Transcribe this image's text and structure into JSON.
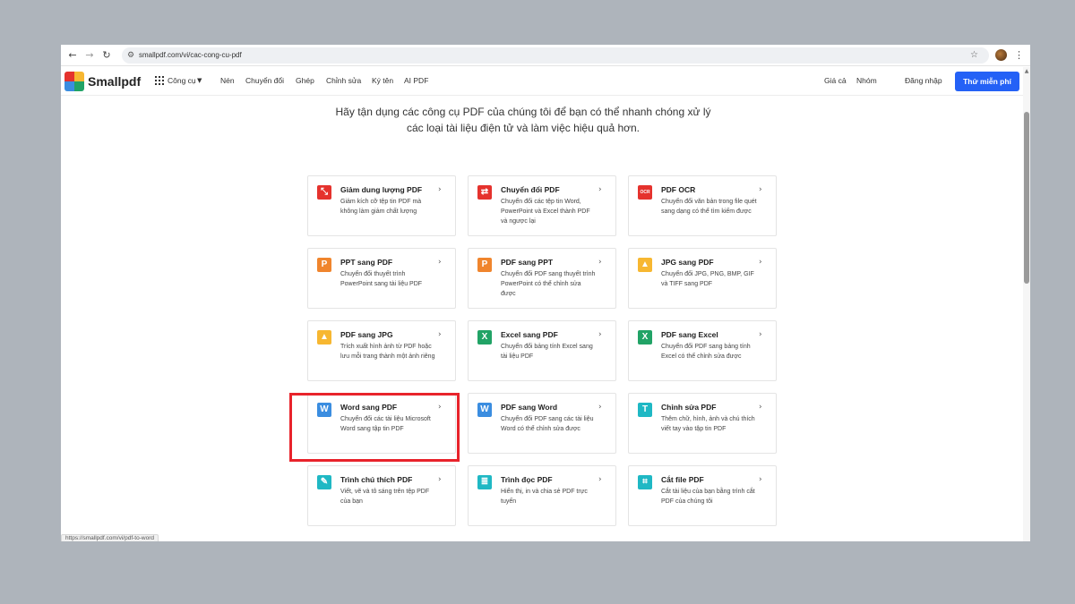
{
  "browser": {
    "back_icon": "arrow-left-icon",
    "forward_icon": "arrow-right-icon",
    "reload_icon": "reload-icon",
    "url": "smallpdf.com/vi/cac-cong-cu-pdf",
    "status_url": "https://smallpdf.com/vi/pdf-to-word"
  },
  "header": {
    "brand": "Smallpdf",
    "tools_label": "Công cụ",
    "nav": [
      "Nén",
      "Chuyển đổi",
      "Ghép",
      "Chỉnh sửa",
      "Ký tên",
      "AI PDF"
    ],
    "right_links": [
      "Giá cả",
      "Nhóm",
      "Đăng nhập"
    ],
    "cta": "Thử miễn phí",
    "cta_color": "#2461f6"
  },
  "intro": {
    "line1": "Hãy tận dụng các công cụ PDF của chúng tôi để bạn có thể nhanh chóng xử lý",
    "line2": "các loại tài liệu điện tử và làm việc hiệu quả hơn."
  },
  "cards": [
    {
      "title": "Giảm dung lượng PDF",
      "desc": "Giảm kích cỡ tệp tin PDF mà không làm giảm chất lượng",
      "icon": "compress-icon",
      "color": "#e5322d",
      "glyph": "⤡"
    },
    {
      "title": "Chuyển đổi PDF",
      "desc": "Chuyển đổi các tệp tin Word, PowerPoint và Excel thành PDF và ngược lại",
      "icon": "convert-icon",
      "color": "#e5322d",
      "glyph": "⇄"
    },
    {
      "title": "PDF OCR",
      "desc": "Chuyển đổi văn bản trong file quét sang dạng có thể tìm kiếm được",
      "icon": "ocr-icon",
      "color": "#e5322d",
      "glyph": "OCR"
    },
    {
      "title": "PPT sang PDF",
      "desc": "Chuyển đổi thuyết trình PowerPoint sang tài liệu PDF",
      "icon": "powerpoint-icon",
      "color": "#f0852d",
      "glyph": "P"
    },
    {
      "title": "PDF sang PPT",
      "desc": "Chuyển đổi PDF sang thuyết trình PowerPoint có thể chỉnh sửa được",
      "icon": "powerpoint-icon",
      "color": "#f0852d",
      "glyph": "P"
    },
    {
      "title": "JPG sang PDF",
      "desc": "Chuyển đổi JPG, PNG, BMP, GIF và TIFF sang PDF",
      "icon": "image-icon",
      "color": "#f7b731",
      "glyph": "▲"
    },
    {
      "title": "PDF sang JPG",
      "desc": "Trích xuất hình ảnh từ PDF hoặc lưu mỗi trang thành một ảnh riêng",
      "icon": "image-icon",
      "color": "#f7b731",
      "glyph": "▲"
    },
    {
      "title": "Excel sang PDF",
      "desc": "Chuyển đổi bảng tính Excel sang tài liệu PDF",
      "icon": "excel-icon",
      "color": "#21a366",
      "glyph": "X"
    },
    {
      "title": "PDF sang Excel",
      "desc": "Chuyển đổi PDF sang bảng tính Excel có thể chỉnh sửa được",
      "icon": "excel-icon",
      "color": "#21a366",
      "glyph": "X"
    },
    {
      "title": "Word sang PDF",
      "desc": "Chuyển đổi các tài liệu Microsoft Word sang tập tin PDF",
      "icon": "word-icon",
      "color": "#3b8de0",
      "glyph": "W"
    },
    {
      "title": "PDF sang Word",
      "desc": "Chuyển đổi PDF sang các tài liệu Word có thể chỉnh sửa được",
      "icon": "word-icon",
      "color": "#3b8de0",
      "glyph": "W"
    },
    {
      "title": "Chỉnh sửa PDF",
      "desc": "Thêm chữ, hình, ảnh và chú thích viết tay vào tập tin PDF",
      "icon": "text-edit-icon",
      "color": "#1fb8c4",
      "glyph": "T"
    },
    {
      "title": "Trình chú thích PDF",
      "desc": "Viết, vẽ và tô sáng trên tệp PDF của bạn",
      "icon": "pen-icon",
      "color": "#1fb8c4",
      "glyph": "✎"
    },
    {
      "title": "Trình đọc PDF",
      "desc": "Hiển thị, in và chia sẻ PDF trực tuyến",
      "icon": "reader-icon",
      "color": "#1fb8c4",
      "glyph": "≣"
    },
    {
      "title": "Cắt file PDF",
      "desc": "Cắt tài liệu của bạn bằng trình cắt PDF của chúng tôi",
      "icon": "crop-icon",
      "color": "#1fb8c4",
      "glyph": "⌗"
    }
  ],
  "highlight_color": "#e8232b"
}
